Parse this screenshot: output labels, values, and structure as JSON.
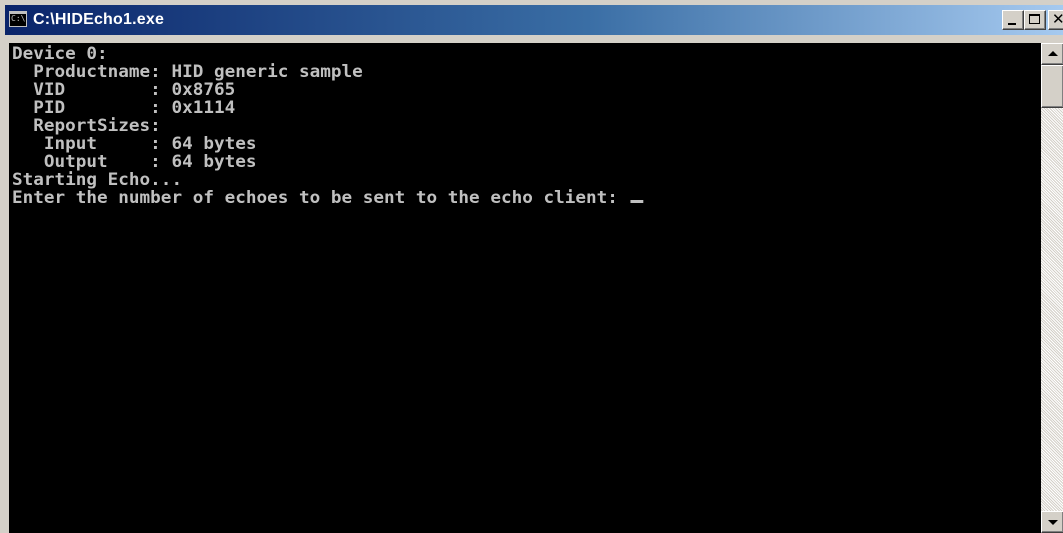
{
  "window": {
    "title": "C:\\HIDEcho1.exe",
    "icon": "console-app-icon",
    "icon_text": "C:\\"
  },
  "console": {
    "lines": [
      "Device 0:",
      "  Productname: HID generic sample",
      "  VID        : 0x8765",
      "  PID        : 0x1114",
      "  ReportSizes:",
      "   Input     : 64 bytes",
      "   Output    : 64 bytes",
      "Starting Echo...",
      "Enter the number of echoes to be sent to the echo client: "
    ],
    "text_color": "#c0c0c0",
    "background_color": "#000000"
  },
  "titlebar_colors": {
    "active_start": "#0a246a",
    "active_end": "#a6caf0"
  }
}
